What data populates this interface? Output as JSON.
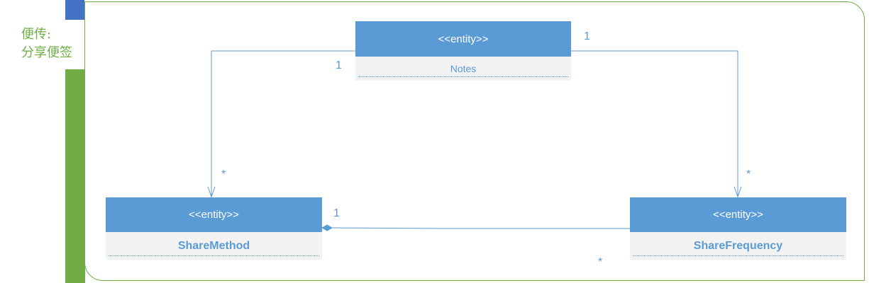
{
  "swimlane": {
    "label_line1": "便传:",
    "label_line2": "分享便签"
  },
  "entities": {
    "notes": {
      "stereotype": "<<entity>>",
      "name": "Notes"
    },
    "share_method": {
      "stereotype": "<<entity>>",
      "name": "ShareMethod"
    },
    "share_frequency": {
      "stereotype": "<<entity>>",
      "name": "ShareFrequency"
    }
  },
  "multiplicities": {
    "notes_to_method_source": "1",
    "notes_to_method_target": "*",
    "notes_to_freq_source": "1",
    "notes_to_freq_target": "*",
    "method_composition": "1",
    "frequency_side": "*"
  },
  "colors": {
    "entity_header": "#5b9bd5",
    "entity_body": "#f2f2f2",
    "lane_green": "#70ad47",
    "lane_blue": "#4472c4"
  }
}
